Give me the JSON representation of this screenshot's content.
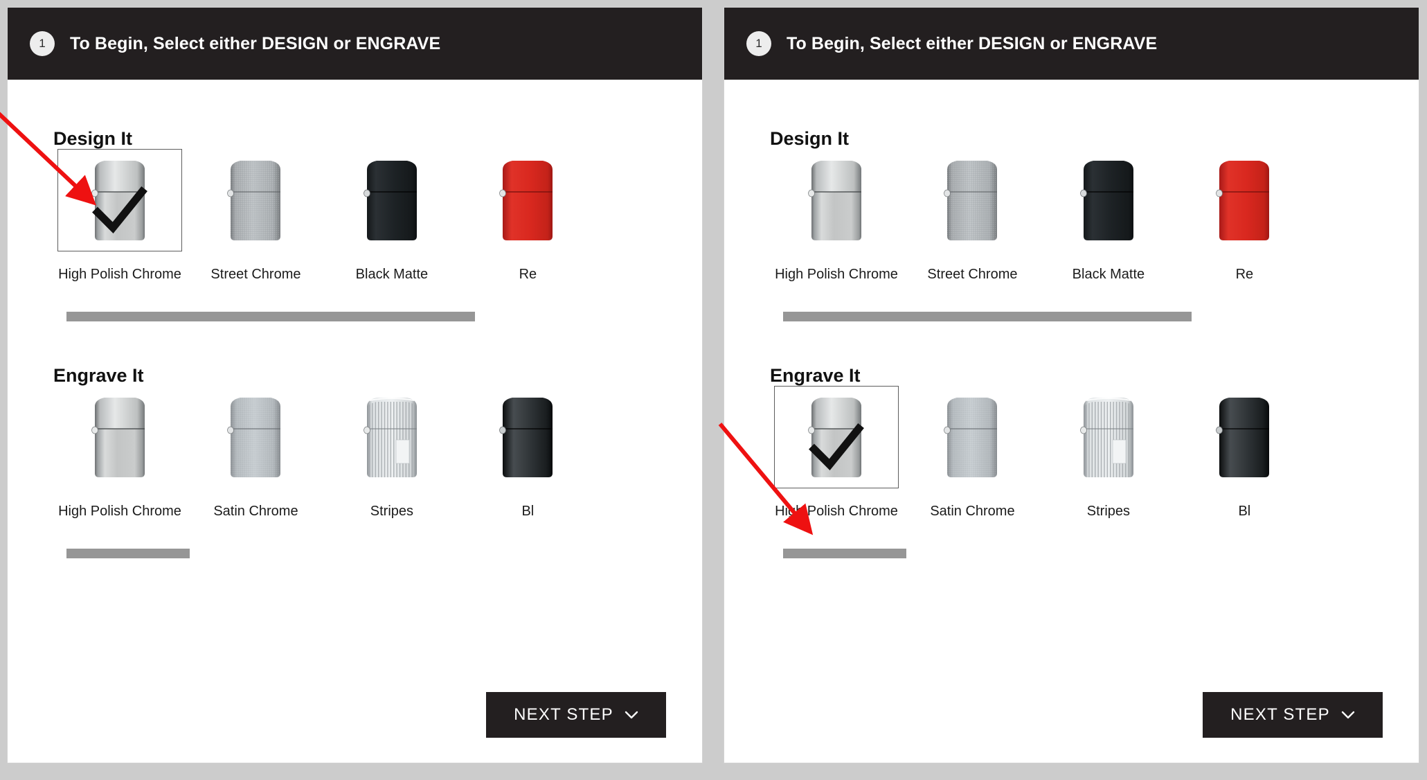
{
  "panels": [
    {
      "id": "left-panel",
      "header": {
        "step_number": "1",
        "title": "To Begin, Select either DESIGN or ENGRAVE"
      },
      "design": {
        "title": "Design It",
        "items": [
          {
            "label": "High Polish Chrome",
            "finish": "polished-chrome",
            "selected": true
          },
          {
            "label": "Street Chrome",
            "finish": "street-chrome",
            "selected": false
          },
          {
            "label": "Black Matte",
            "finish": "black-matte",
            "selected": false
          },
          {
            "label": "Re",
            "finish": "red-matte",
            "selected": false
          }
        ],
        "scrollbar": {
          "thumb_left_pct": 2,
          "thumb_width_pct": 63
        }
      },
      "engrave": {
        "title": "Engrave It",
        "items": [
          {
            "label": "High Polish Chrome",
            "finish": "polished-chrome",
            "selected": false
          },
          {
            "label": "Satin Chrome",
            "finish": "satin-chrome",
            "selected": false
          },
          {
            "label": "Stripes",
            "finish": "stripes",
            "selected": false
          },
          {
            "label": "Bl",
            "finish": "black-ice",
            "selected": false
          }
        ],
        "scrollbar": {
          "thumb_left_pct": 2,
          "thumb_width_pct": 19
        }
      },
      "next_step": {
        "label": "NEXT STEP",
        "icon": "chevron-down-icon"
      },
      "annotation": {
        "arrow": "red-arrow",
        "points_to": "design-it-first-swatch"
      }
    },
    {
      "id": "right-panel",
      "header": {
        "step_number": "1",
        "title": "To Begin, Select either DESIGN or ENGRAVE"
      },
      "design": {
        "title": "Design It",
        "items": [
          {
            "label": "High Polish Chrome",
            "finish": "polished-chrome",
            "selected": false
          },
          {
            "label": "Street Chrome",
            "finish": "street-chrome",
            "selected": false
          },
          {
            "label": "Black Matte",
            "finish": "black-matte",
            "selected": false
          },
          {
            "label": "Re",
            "finish": "red-matte",
            "selected": false
          }
        ],
        "scrollbar": {
          "thumb_left_pct": 2,
          "thumb_width_pct": 63
        }
      },
      "engrave": {
        "title": "Engrave It",
        "items": [
          {
            "label": "High Polish Chrome",
            "finish": "polished-chrome",
            "selected": true
          },
          {
            "label": "Satin Chrome",
            "finish": "satin-chrome",
            "selected": false
          },
          {
            "label": "Stripes",
            "finish": "stripes",
            "selected": false
          },
          {
            "label": "Bl",
            "finish": "black-ice",
            "selected": false
          }
        ],
        "scrollbar": {
          "thumb_left_pct": 2,
          "thumb_width_pct": 19
        }
      },
      "next_step": {
        "label": "NEXT STEP",
        "icon": "chevron-down-icon"
      },
      "annotation": {
        "arrow": "red-arrow",
        "points_to": "engrave-it-first-swatch"
      }
    }
  ],
  "colors": {
    "header_bg": "#231f20",
    "page_bg": "#cccccc",
    "panel_bg": "#ffffff",
    "scroll_thumb": "#969696",
    "annotation_arrow": "#ee1111",
    "selection_border": "#5c5c5c"
  }
}
